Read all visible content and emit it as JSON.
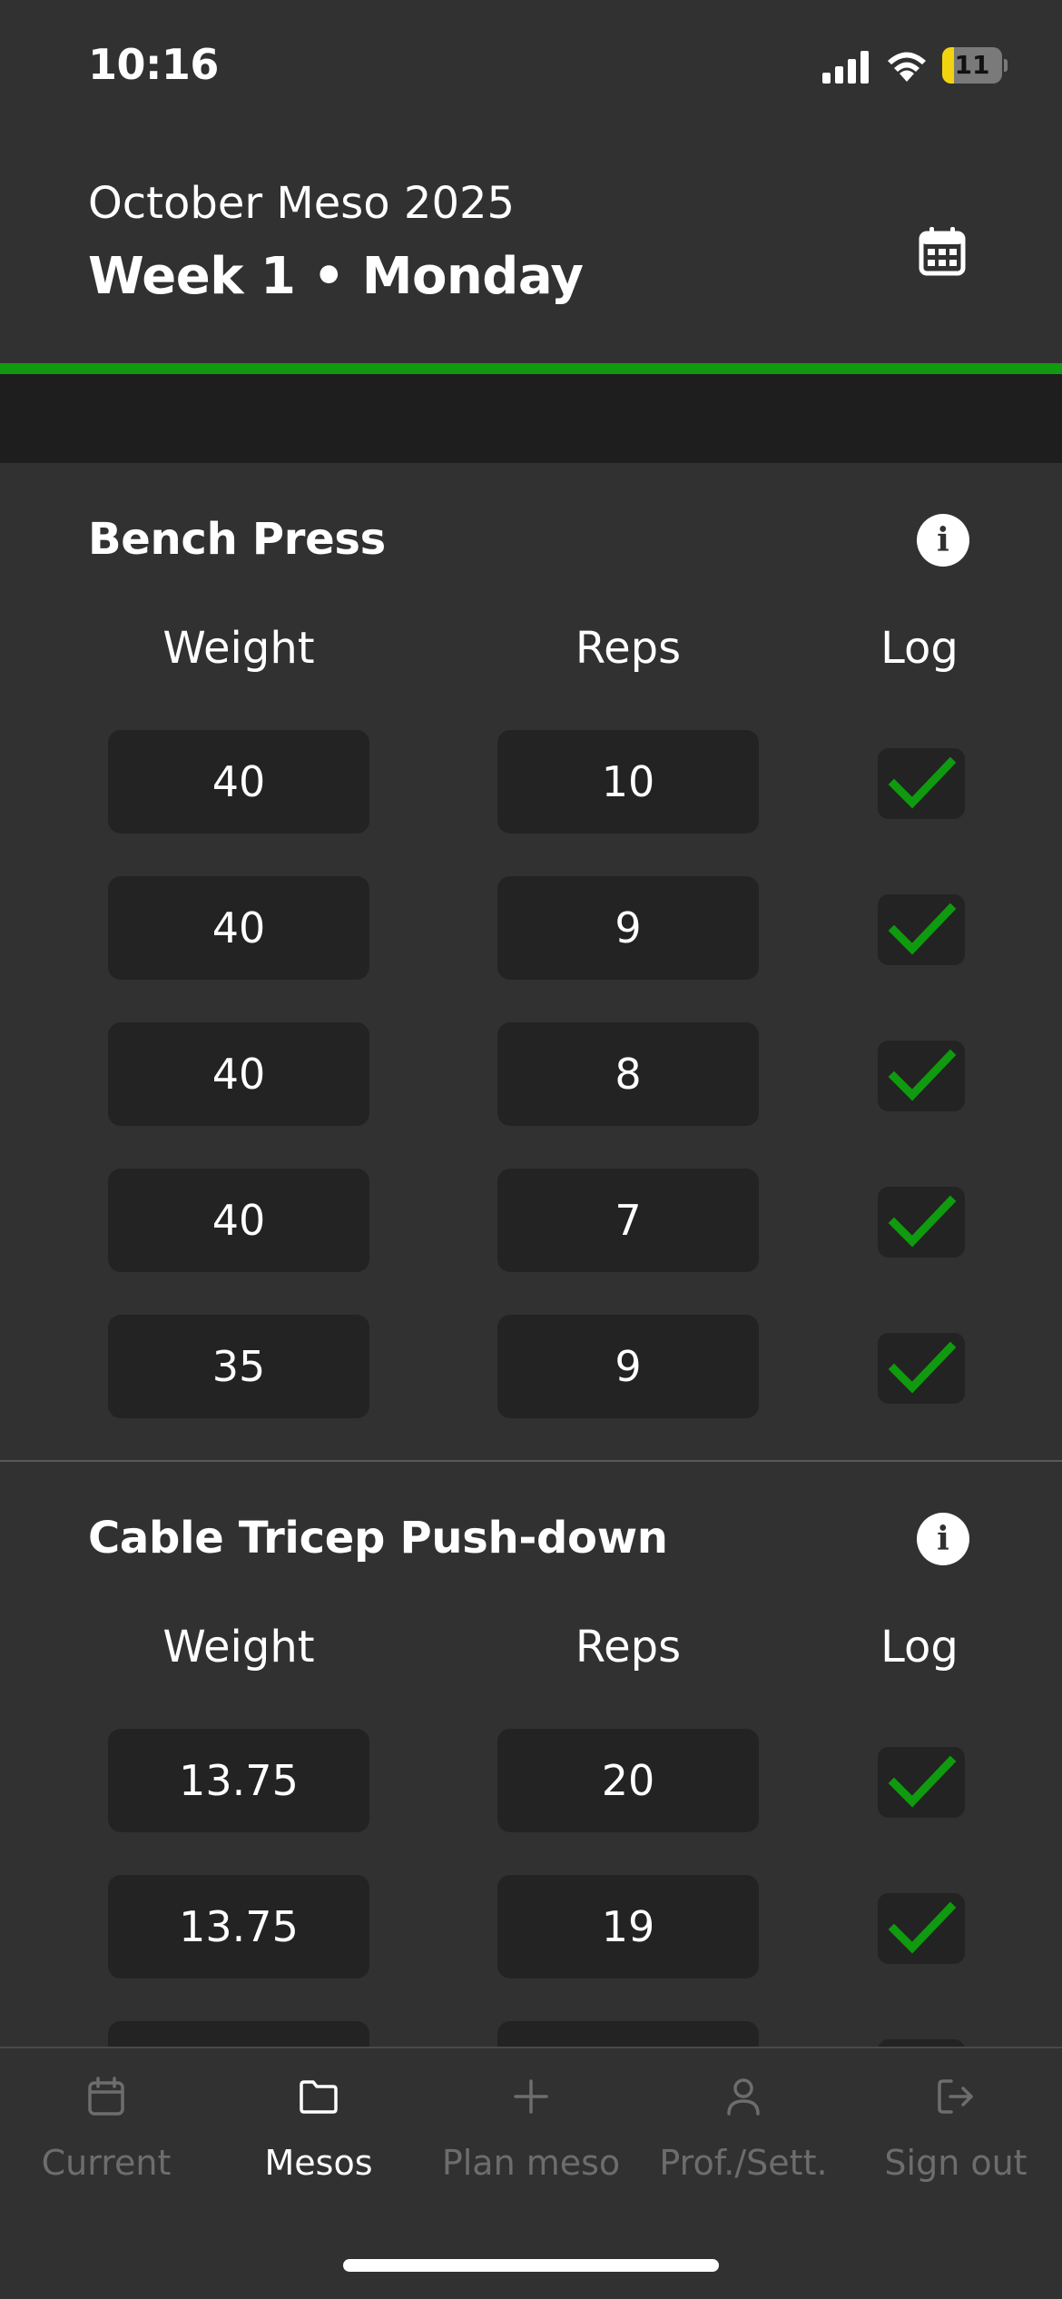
{
  "status_bar": {
    "time": "10:16",
    "battery_level": "11",
    "battery_fraction": 0.2
  },
  "header": {
    "meso_name": "October Meso 2025",
    "day_title": "Week 1 • Monday",
    "calendar_icon": "calendar-icon",
    "progress_fraction": 1.0,
    "progress_color": "#0f9a0f"
  },
  "exercises": [
    {
      "name": "Bench Press",
      "columns": {
        "weight": "Weight",
        "reps": "Reps",
        "log": "Log"
      },
      "sets": [
        {
          "weight": "40",
          "reps": "10",
          "logged": true
        },
        {
          "weight": "40",
          "reps": "9",
          "logged": true
        },
        {
          "weight": "40",
          "reps": "8",
          "logged": true
        },
        {
          "weight": "40",
          "reps": "7",
          "logged": true
        },
        {
          "weight": "35",
          "reps": "9",
          "logged": true
        }
      ]
    },
    {
      "name": "Cable Tricep Push-down",
      "columns": {
        "weight": "Weight",
        "reps": "Reps",
        "log": "Log"
      },
      "sets": [
        {
          "weight": "13.75",
          "reps": "20",
          "logged": true
        },
        {
          "weight": "13.75",
          "reps": "19",
          "logged": true
        }
      ]
    }
  ],
  "colors": {
    "check": "#0f9a0f",
    "background": "#313131",
    "input": "#232323"
  },
  "bottom_nav": {
    "active": "Mesos",
    "items": [
      {
        "label": "Current",
        "icon": "calendar-icon"
      },
      {
        "label": "Mesos",
        "icon": "folder-icon"
      },
      {
        "label": "Plan meso",
        "icon": "plus-icon"
      },
      {
        "label": "Prof./Sett.",
        "icon": "user-icon"
      },
      {
        "label": "Sign out",
        "icon": "sign-out-icon"
      }
    ]
  }
}
